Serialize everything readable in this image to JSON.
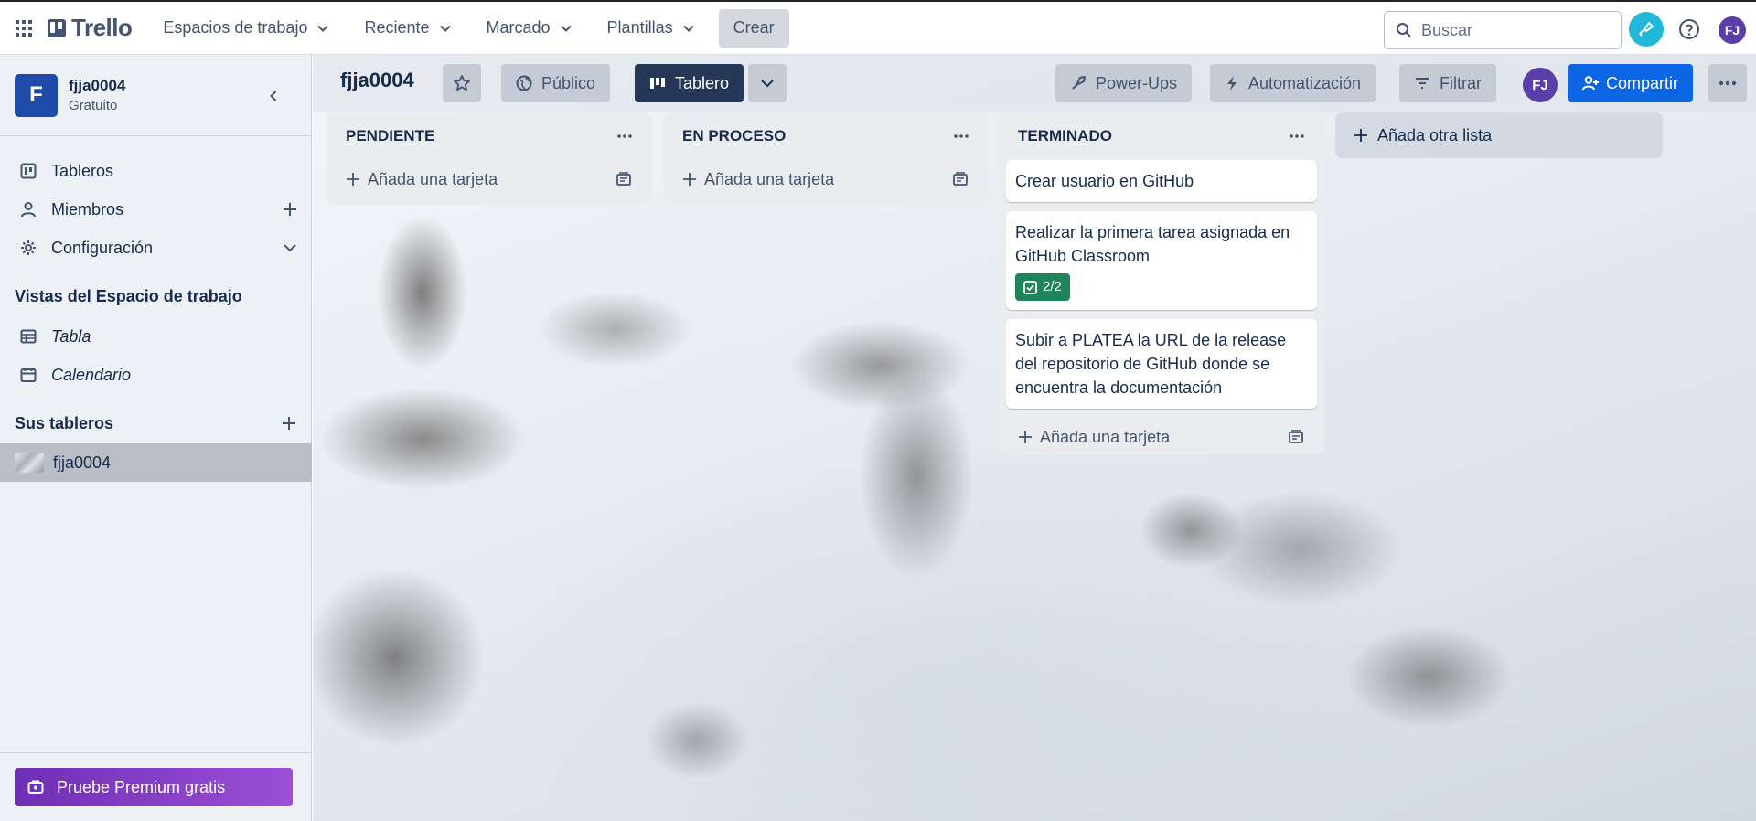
{
  "topbar": {
    "app_name": "Trello",
    "menus": [
      "Espacios de trabajo",
      "Reciente",
      "Marcado",
      "Plantillas"
    ],
    "create_label": "Crear",
    "search_placeholder": "Buscar",
    "avatar_initials": "FJ"
  },
  "sidebar": {
    "workspace_initial": "F",
    "workspace_name": "fjja0004",
    "workspace_plan": "Gratuito",
    "items": [
      {
        "label": "Tableros"
      },
      {
        "label": "Miembros"
      },
      {
        "label": "Configuración"
      }
    ],
    "views_heading": "Vistas del Espacio de trabajo",
    "views": [
      {
        "label": "Tabla"
      },
      {
        "label": "Calendario"
      }
    ],
    "boards_heading": "Sus tableros",
    "boards": [
      {
        "label": "fjja0004"
      }
    ],
    "premium_label": "Pruebe Premium gratis"
  },
  "board": {
    "title": "fjja0004",
    "visibility_label": "Público",
    "view_label": "Tablero",
    "powerups_label": "Power-Ups",
    "automation_label": "Automatización",
    "filter_label": "Filtrar",
    "member_initials": "FJ",
    "share_label": "Compartir",
    "add_list_label": "Añada otra lista"
  },
  "lists": [
    {
      "title": "PENDIENTE",
      "add_card_label": "Añada una tarjeta",
      "cards": []
    },
    {
      "title": "EN PROCESO",
      "add_card_label": "Añada una tarjeta",
      "cards": []
    },
    {
      "title": "TERMINADO",
      "add_card_label": "Añada una tarjeta",
      "cards": [
        {
          "text": "Crear usuario en GitHub"
        },
        {
          "text": "Realizar la primera tarea asignada en GitHub Classroom",
          "checklist": "2/2"
        },
        {
          "text": "Subir a PLATEA la URL de la release del repositorio de GitHub donde se encuentra la documentación"
        }
      ]
    }
  ],
  "colors": {
    "brand_blue": "#0c66e4",
    "nav_dark": "#253858",
    "checklist_done": "#1f845a",
    "premium_purple": "#6e2fb5"
  }
}
